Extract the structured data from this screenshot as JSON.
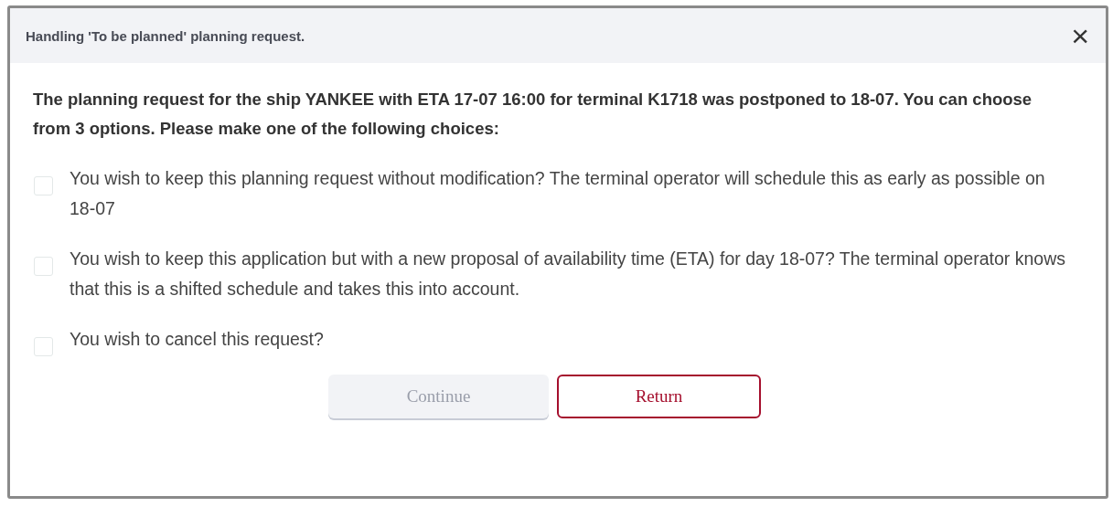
{
  "dialog": {
    "title": "Handling 'To be planned' planning request.",
    "close": "×"
  },
  "message": "The planning request for the ship YANKEE with ETA 17-07 16:00 for terminal K1718 was postponed to 18-07. You can choose from 3 options. Please make one of the following choices:",
  "options": [
    {
      "label": "You wish to keep this planning request without modification? The terminal operator will schedule this as early as possible on 18-07",
      "checked": false
    },
    {
      "label": "You wish to keep this application but with a new proposal of availability time (ETA) for day 18-07? The terminal operator knows that this is a shifted schedule and takes this into account.",
      "checked": false
    },
    {
      "label": "You wish to cancel this request?",
      "checked": false
    }
  ],
  "buttons": [
    {
      "label": "Continue",
      "kind": "primary",
      "disabled": true
    },
    {
      "label": "Return",
      "kind": "secondary",
      "disabled": false
    }
  ]
}
